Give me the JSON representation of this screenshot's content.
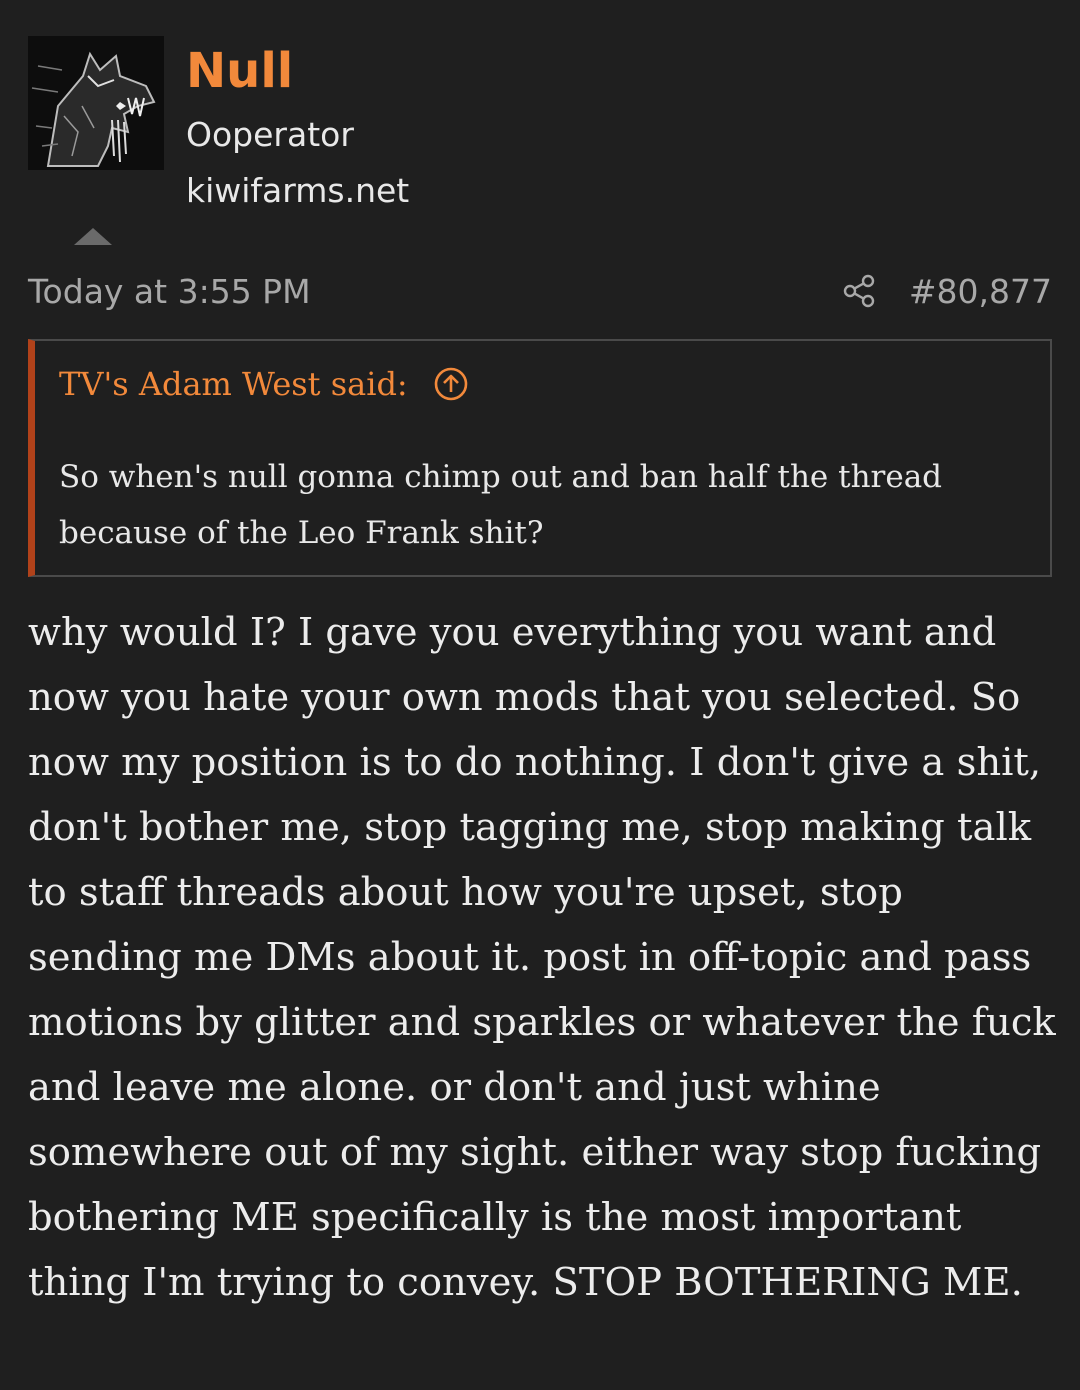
{
  "user": {
    "name": "Null",
    "title": "Ooperator",
    "site": "kiwifarms.net"
  },
  "post": {
    "time": "Today at 3:55 PM",
    "number": "#80,877"
  },
  "quote": {
    "attribution": "TV's Adam West said:",
    "text": "So when's null gonna chimp out and ban half the thread because of the Leo Frank shit?"
  },
  "message": {
    "text": "why would I? I gave you everything you want and now you hate your own mods that you selected. So now my position is to do nothing. I don't give a shit, don't bother me, stop tagging me, stop making talk to staff threads about how you're upset, stop sending me DMs about it. post in off-topic and pass motions by glitter and sparkles or whatever the fuck and leave me alone. or don't and just whine somewhere out of my sight. either way stop fucking bothering ME specifically is the most important thing I'm trying to convey. STOP BOTHERING ME."
  },
  "icons": {
    "share": "share-icon",
    "jump": "arrow-up-circle-icon",
    "collapse": "caret-up-icon"
  },
  "colors": {
    "background": "#1f1f1f",
    "accent": "#f2893b",
    "quote_bar": "#b1421a",
    "muted": "#a8a8a8"
  }
}
